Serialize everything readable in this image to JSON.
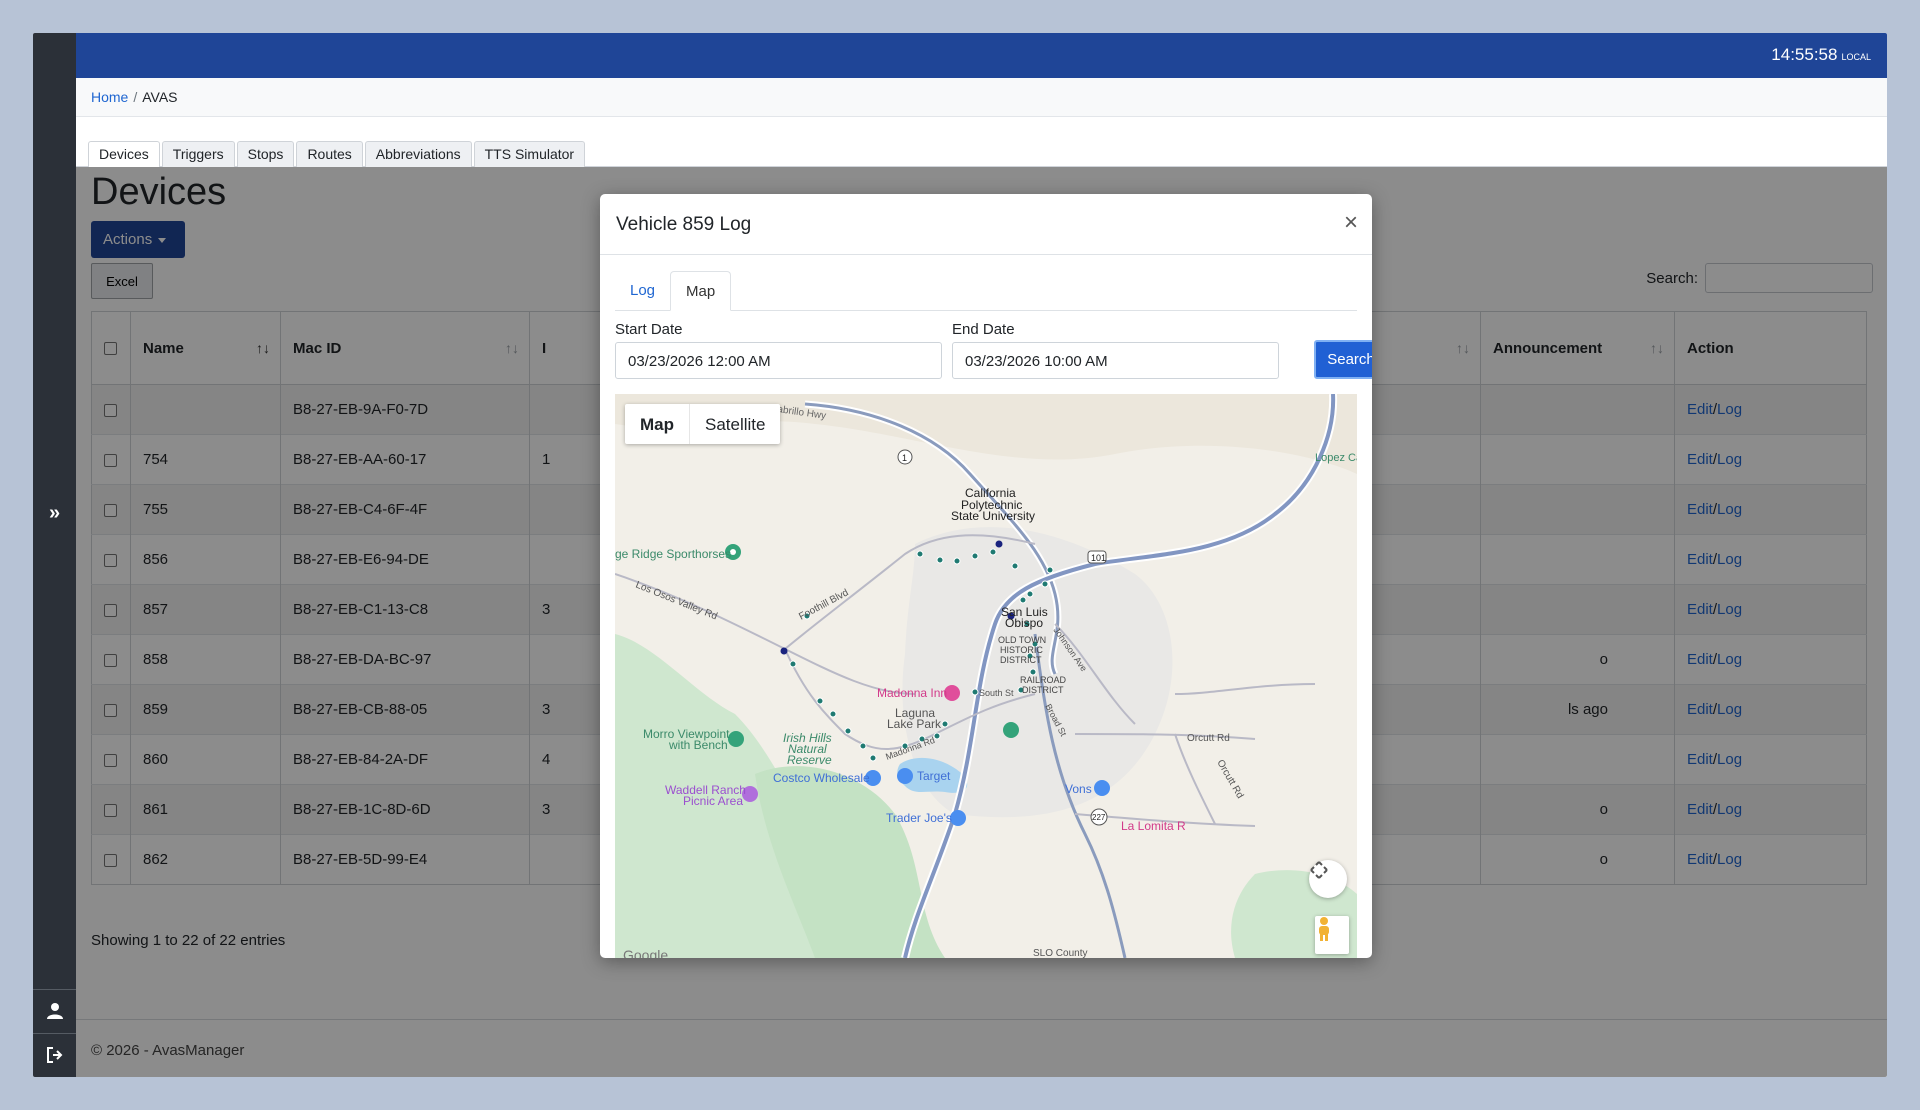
{
  "topbar": {
    "clock": "14:55:58",
    "clock_zone": "LOCAL"
  },
  "breadcrumb": {
    "home": "Home",
    "current": "AVAS"
  },
  "tabs": [
    "Devices",
    "Triggers",
    "Stops",
    "Routes",
    "Abbreviations",
    "TTS Simulator"
  ],
  "page": {
    "title": "Devices",
    "actions_label": "Actions",
    "excel_label": "Excel",
    "search_label": "Search:",
    "entries_text": "Showing 1 to 22 of 22 entries"
  },
  "table": {
    "headers": {
      "name": "Name",
      "mac": "Mac ID",
      "col3": "I",
      "announcement": "Announcement",
      "action": "Action"
    },
    "rows": [
      {
        "name": "",
        "mac": "B8-27-EB-9A-F0-7D",
        "c3": "",
        "c4": ""
      },
      {
        "name": "754",
        "mac": "B8-27-EB-AA-60-17",
        "c3": "1",
        "c4": ""
      },
      {
        "name": "755",
        "mac": "B8-27-EB-C4-6F-4F",
        "c3": "",
        "c4": ""
      },
      {
        "name": "856",
        "mac": "B8-27-EB-E6-94-DE",
        "c3": "",
        "c4": ""
      },
      {
        "name": "857",
        "mac": "B8-27-EB-C1-13-C8",
        "c3": "3",
        "c4": ""
      },
      {
        "name": "858",
        "mac": "B8-27-EB-DA-BC-97",
        "c3": "",
        "c4": "o"
      },
      {
        "name": "859",
        "mac": "B8-27-EB-CB-88-05",
        "c3": "3",
        "c4": "ls ago"
      },
      {
        "name": "860",
        "mac": "B8-27-EB-84-2A-DF",
        "c3": "4",
        "c4": ""
      },
      {
        "name": "861",
        "mac": "B8-27-EB-1C-8D-6D",
        "c3": "3",
        "c4": "o"
      },
      {
        "name": "862",
        "mac": "B8-27-EB-5D-99-E4",
        "c3": "",
        "c4": "o"
      }
    ],
    "edit_label": "Edit",
    "slash": "/",
    "log_label": "Log"
  },
  "footer": {
    "text": "© 2026 - AvasManager"
  },
  "modal": {
    "title": "Vehicle 859 Log",
    "close": "×",
    "tabs": [
      "Log",
      "Map"
    ],
    "start_label": "Start Date",
    "start_value": "03/23/2026 12:00 AM",
    "end_label": "End Date",
    "end_value": "03/23/2026 10:00 AM",
    "search_label": "Search",
    "map": {
      "type_map": "Map",
      "type_satellite": "Satellite",
      "labels": {
        "cabrillo": "Cabrillo Hwy",
        "lopez": "Lopez Ca",
        "calpoly1": "California",
        "calpoly2": "Polytechnic",
        "calpoly3": "State University",
        "sporthorses": "ge Ridge Sporthorses",
        "losososvalley": "Los Osos Valley Rd",
        "foothill": "Foothill Blvd",
        "slo1": "San Luis",
        "slo2": "Obispo",
        "oldtown1": "OLD TOWN",
        "oldtown2": "HISTORIC",
        "oldtown3": "DISTRICT",
        "johnson": "Johnson Ave",
        "railroad1": "RAILROAD",
        "railroad2": "DISTRICT",
        "madonna": "Madonna Inn",
        "south": "South St",
        "laguna1": "Laguna",
        "laguna2": "Lake Park",
        "broad": "Broad St",
        "orcutt": "Orcutt Rd",
        "orcutt2": "Orcutt Rd",
        "morro1": "Morro Viewpoint",
        "morro2": "with Bench",
        "irish1": "Irish Hills",
        "irish2": "Natural",
        "irish3": "Reserve",
        "madonnard": "Madonna Rd",
        "costco": "Costco Wholesale",
        "target": "Target",
        "vons": "Vons",
        "waddell1": "Waddell Ranch",
        "waddell2": "Picnic Area",
        "traderjoes": "Trader Joe's",
        "lalomita": "La Lomita R",
        "hw1": "1",
        "hw101": "101",
        "hw227": "227",
        "slocounty": "SLO County",
        "google": "Google"
      }
    }
  }
}
